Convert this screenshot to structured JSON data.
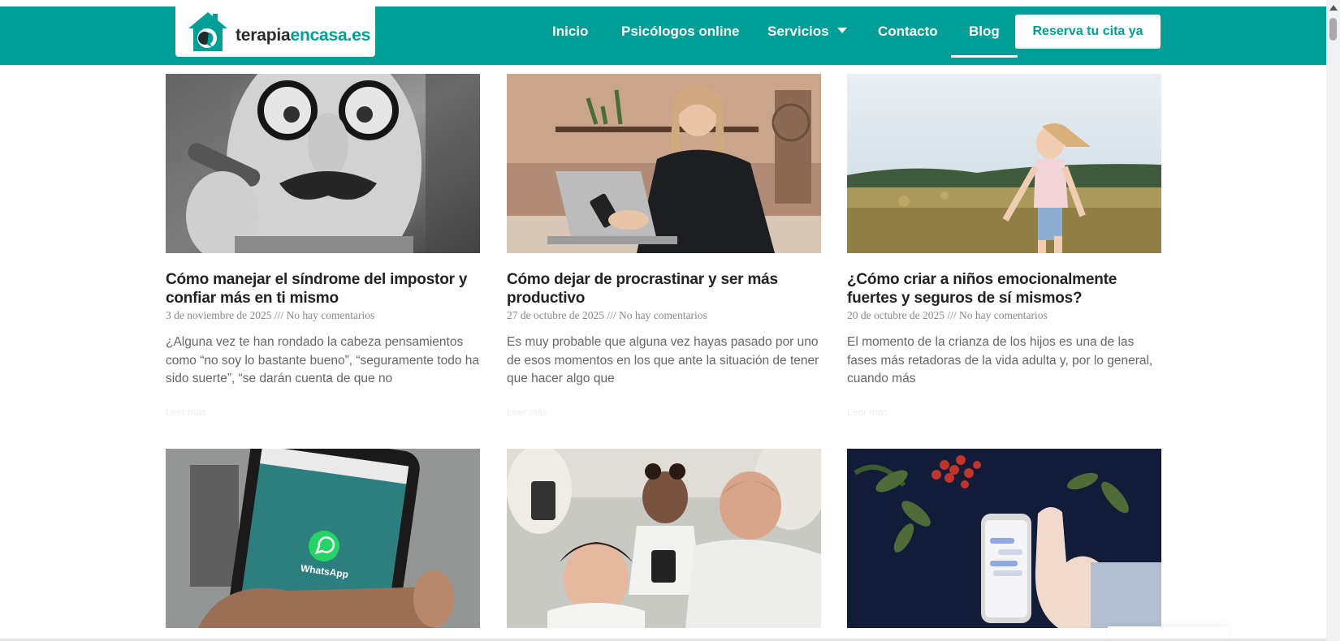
{
  "brand": {
    "logo_text_main": "terapia",
    "logo_text_accent": "encasa",
    "logo_text_tld": ".es",
    "primary_color": "#009e96"
  },
  "nav": {
    "items": [
      {
        "label": "Inicio"
      },
      {
        "label": "Psicólogos online"
      },
      {
        "label": "Servicios",
        "has_dropdown": true
      },
      {
        "label": "Contacto"
      },
      {
        "label": "Blog",
        "active": true
      }
    ],
    "cta_label": "Reserva tu cita ya"
  },
  "posts": [
    {
      "title": "Cómo manejar el síndrome del impostor y confiar más en ti mismo",
      "date": "3 de noviembre de 2025",
      "separator": "///",
      "comments": "No hay comentarios",
      "excerpt": "¿Alguna vez te han rondado la cabeza pensamientos como “no soy lo bastante bueno”, “seguramente todo ha sido suerte”, “se darán cuenta de que no",
      "read_more": "Leer más",
      "image": "man-with-disguise-glasses-and-cigar"
    },
    {
      "title": "Cómo dejar de procrastinar y ser más productivo",
      "date": "27 de octubre de 2025",
      "separator": "///",
      "comments": "No hay comentarios",
      "excerpt": "Es muy probable que alguna vez hayas pasado por uno de esos momentos en los que ante la situación de tener que hacer algo que",
      "read_more": "Leer más",
      "image": "woman-on-laptop-and-phone"
    },
    {
      "title": "¿Cómo criar a niños emocionalmente fuertes y seguros de sí mismos?",
      "date": "20 de octubre de 2025",
      "separator": "///",
      "comments": "No hay comentarios",
      "excerpt": "El momento de la crianza de los hijos es una de las fases más retadoras de la vida adulta y, por lo general, cuando más",
      "read_more": "Leer más",
      "image": "girl-running-in-field"
    },
    {
      "image": "hand-holding-phone-whatsapp",
      "screen_text": "WhatsApp"
    },
    {
      "image": "family-looking-at-phones"
    },
    {
      "image": "hand-and-phone-on-dark-background"
    }
  ]
}
